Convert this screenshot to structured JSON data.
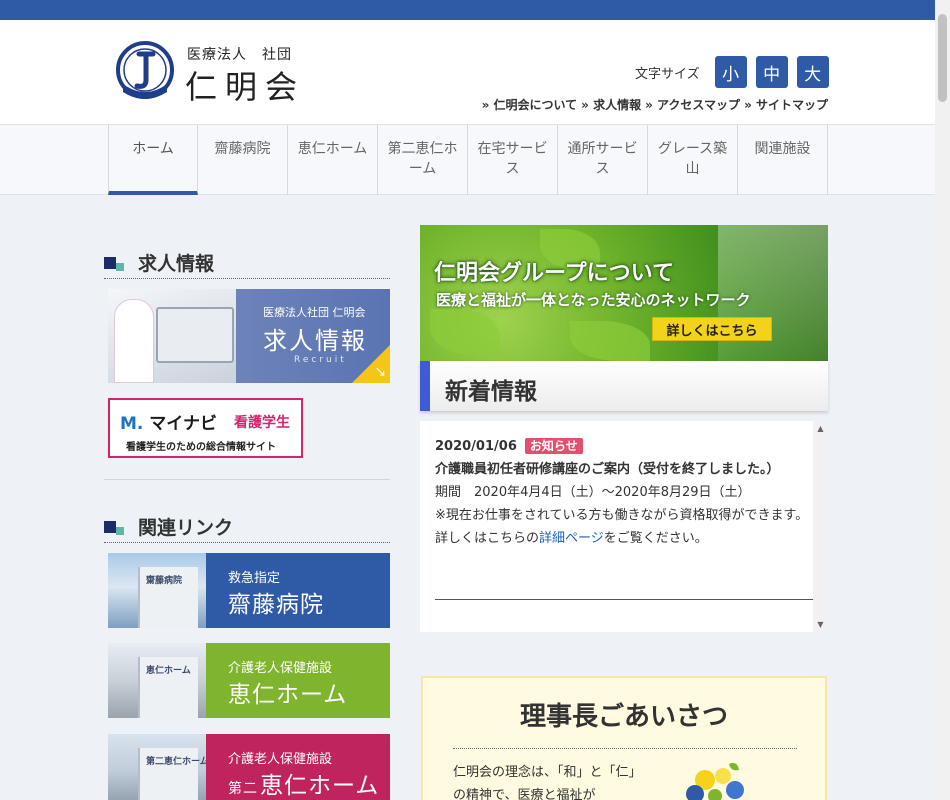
{
  "header": {
    "logo_sub": "医療法人　社団",
    "logo_main": "仁明会",
    "font_size_label": "文字サイズ",
    "font_sizes": [
      "小",
      "中",
      "大"
    ],
    "util_links": [
      "» 仁明会について",
      "» 求人情報",
      "» アクセスマップ",
      "» サイトマップ"
    ]
  },
  "nav": {
    "items": [
      "ホーム",
      "齋藤病院",
      "恵仁ホーム",
      "第二恵仁ホーム",
      "在宅サービス",
      "通所サービス",
      "グレース築山",
      "関連施設"
    ]
  },
  "sidebar": {
    "recruit_heading": "求人情報",
    "recruit_banner": {
      "sub": "医療法人社団 仁明会",
      "title": "求人情報",
      "en": "Recruit",
      "arrow": "↘"
    },
    "mynavi": {
      "logo_mark": "M.",
      "logo": "マイナビ",
      "kango": "看護学生",
      "sub": "看護学生のための総合情報サイト"
    },
    "links_heading": "関連リンク",
    "links": [
      {
        "small": "救急指定",
        "big": "齋藤病院",
        "prefix": "",
        "photo_sign": "齋藤病院"
      },
      {
        "small": "介護老人保健施設",
        "big": "恵仁ホーム",
        "prefix": "",
        "photo_sign": "恵仁ホーム"
      },
      {
        "small": "介護老人保健施設",
        "big": "恵仁ホーム",
        "prefix": "第二",
        "photo_sign": "第二恵仁ホーム"
      }
    ]
  },
  "hero": {
    "title": "仁明会グループについて",
    "subtitle": "医療と福祉が一体となった安心のネットワーク",
    "button": "詳しくはこちら"
  },
  "news": {
    "heading": "新着情報",
    "date": "2020/01/06",
    "badge": "お知らせ",
    "title": "介護職員初任者研修講座のご案内（受付を終了しました。）",
    "period": "期間　2020年4月4日（土）〜2020年8月29日（土）",
    "note": "※現在お仕事をされている方も働きながら資格取得ができます。",
    "detail_prefix": "詳しくはこちらの",
    "detail_link": "詳細ページ",
    "detail_suffix": "をご覧ください。"
  },
  "greeting": {
    "title": "理事長ごあいさつ",
    "body": "仁明会の理念は、「和」と「仁」の精神で、医療と福祉が"
  },
  "colors": {
    "brand_blue": "#2f5aa5",
    "hospital_blue": "#2f5aa5",
    "keijin_green": "#7fb52e",
    "daini_magenta": "#c0245e",
    "news_accent": "#3e5bd6",
    "badge_red": "#e2506d"
  }
}
